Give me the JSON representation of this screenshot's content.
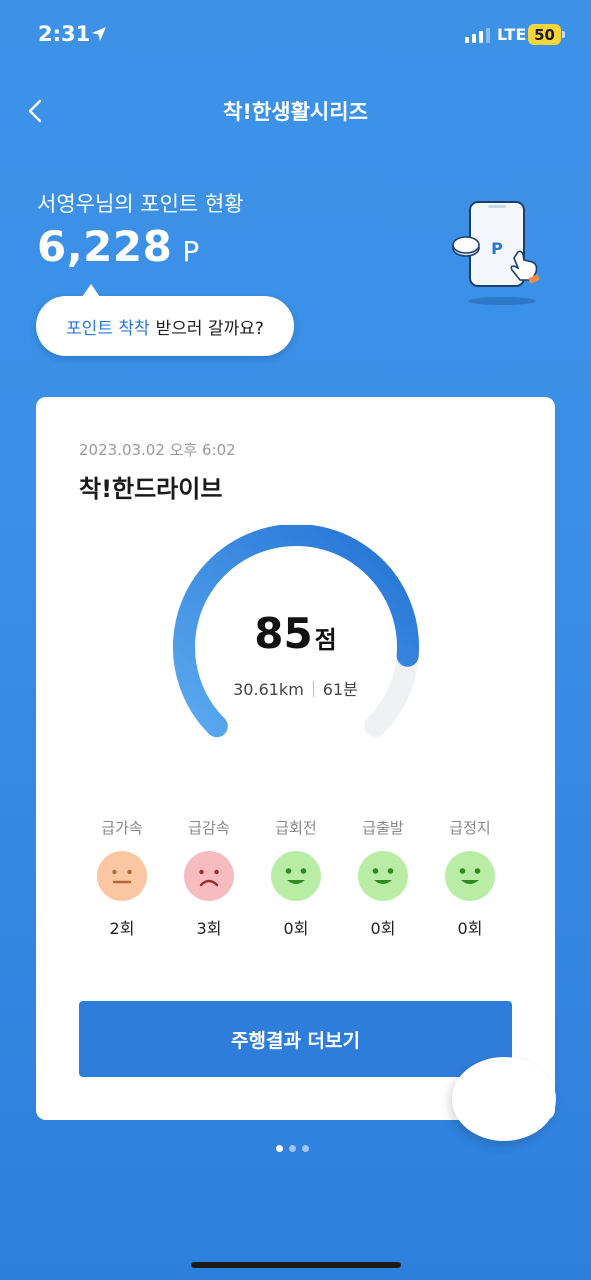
{
  "status_bar": {
    "time": "2:31",
    "network": "LTE",
    "battery": "50"
  },
  "nav": {
    "title": "착!한생활시리즈"
  },
  "points": {
    "label": "서영우님의 포인트 현황",
    "value": "6,228",
    "unit": "P",
    "illustration_letter": "P"
  },
  "bubble": {
    "highlight": "포인트 착착",
    "text": "받으러 갈까요?"
  },
  "card": {
    "date": "2023.03.02 오후 6:02",
    "title": "착!한드라이브",
    "score": "85",
    "score_unit": "점",
    "score_value": 85,
    "distance": "30.61km",
    "duration": "61분",
    "events": [
      {
        "label": "급가속",
        "count": "2회",
        "mood": "neutral",
        "color": "#fbc7a2"
      },
      {
        "label": "급감속",
        "count": "3회",
        "mood": "sad",
        "color": "#f6bcc0"
      },
      {
        "label": "급회전",
        "count": "0회",
        "mood": "happy",
        "color": "#b9eda6"
      },
      {
        "label": "급출발",
        "count": "0회",
        "mood": "happy",
        "color": "#b9eda6"
      },
      {
        "label": "급정지",
        "count": "0회",
        "mood": "happy",
        "color": "#b9eda6"
      }
    ],
    "button_label": "주행결과 더보기"
  },
  "pagination": {
    "total": 3,
    "active": 1
  },
  "colors": {
    "accent": "#2f7ddb",
    "gauge_start": "#5aa9ef",
    "gauge_end": "#2372d4",
    "gauge_track": "#f0f1f3"
  }
}
